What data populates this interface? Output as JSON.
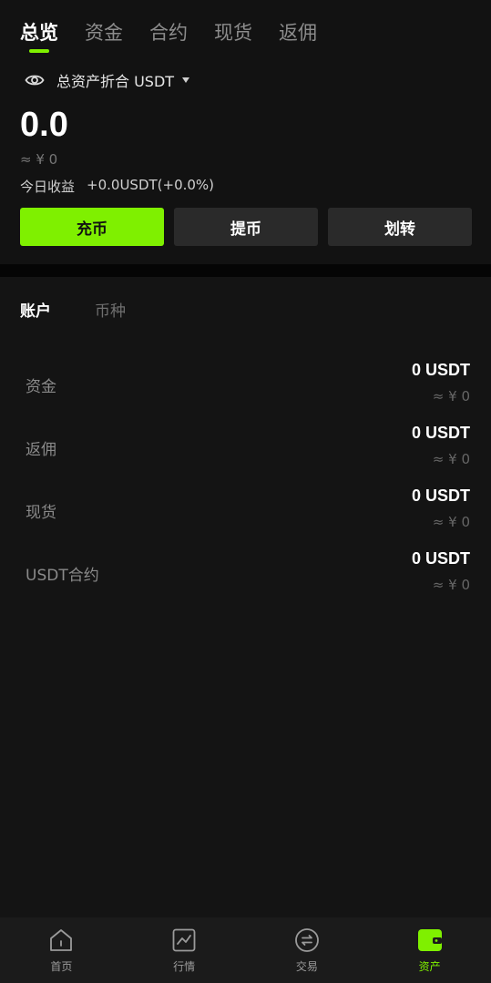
{
  "tabs": [
    "总览",
    "资金",
    "合约",
    "现货",
    "返佣"
  ],
  "asset_label": "总资产折合 USDT",
  "total_value": "0.0",
  "approx_cny": "≈ ¥ 0",
  "today_label": "今日收益",
  "today_value": "+0.0USDT(+0.0%)",
  "buttons": {
    "deposit": "充币",
    "withdraw": "提币",
    "transfer": "划转"
  },
  "subtabs": [
    "账户",
    "币种"
  ],
  "accounts": [
    {
      "name": "资金",
      "amount": "0 USDT",
      "approx": "≈ ¥ 0"
    },
    {
      "name": "返佣",
      "amount": "0 USDT",
      "approx": "≈ ¥ 0"
    },
    {
      "name": "现货",
      "amount": "0 USDT",
      "approx": "≈ ¥ 0"
    },
    {
      "name": "USDT合约",
      "amount": "0 USDT",
      "approx": "≈ ¥ 0"
    }
  ],
  "nav": [
    {
      "label": "首页",
      "icon": "home-icon"
    },
    {
      "label": "行情",
      "icon": "chart-icon"
    },
    {
      "label": "交易",
      "icon": "exchange-icon"
    },
    {
      "label": "资产",
      "icon": "wallet-icon"
    }
  ],
  "colors": {
    "accent": "#7ff000",
    "background": "#141414",
    "button": "#2a2a2a"
  }
}
